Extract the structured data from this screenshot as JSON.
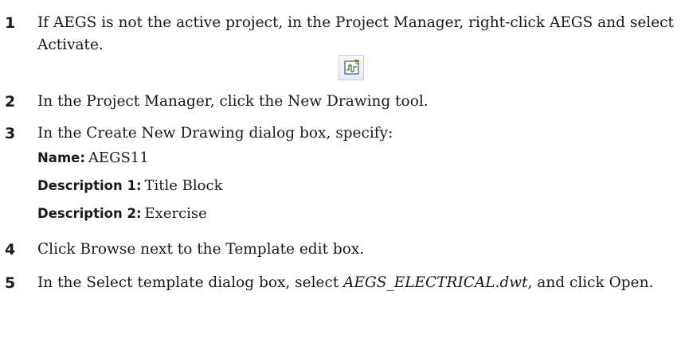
{
  "steps": [
    {
      "num": "1",
      "text": "If AEGS is not the active project, in the Project Manager, right-click AEGS and select Activate."
    },
    {
      "num": "2",
      "text": "In the Project Manager, click the New Drawing tool."
    },
    {
      "num": "3",
      "text": "In the Create New Drawing dialog box, specify:"
    },
    {
      "num": "4",
      "text": "Click Browse next to the Template edit box."
    },
    {
      "num": "5",
      "text_before": "In the Select template dialog box, select ",
      "filename": "AEGS_ELECTRICAL.dwt",
      "text_after": ", and click Open."
    }
  ],
  "fields": [
    {
      "label": "Name:",
      "value": "AEGS11"
    },
    {
      "label": "Description 1:",
      "value": "Title Block"
    },
    {
      "label": "Description 2:",
      "value": "Exercise"
    }
  ],
  "icons": {
    "new_drawing_tool": "new-drawing-icon"
  }
}
